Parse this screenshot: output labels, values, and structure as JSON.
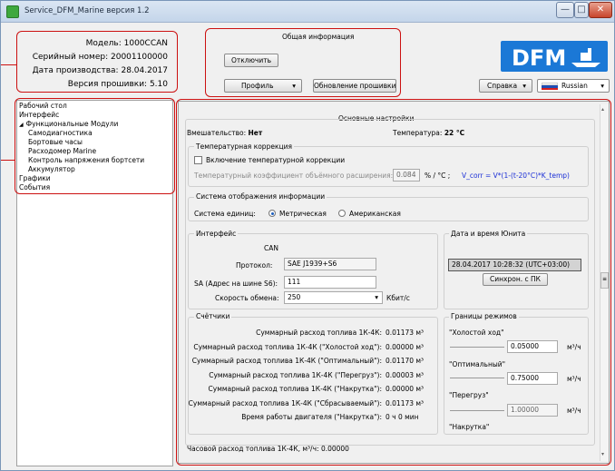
{
  "window": {
    "title": "Service_DFM_Marine версия 1.2",
    "controls": {
      "minimize": "—",
      "maximize": "□",
      "close": "✕"
    }
  },
  "device_info": {
    "model_label": "Модель:",
    "model_value": "1000CCAN",
    "serial_label": "Серийный номер:",
    "serial_value": "20001100000",
    "date_label": "Дата производства:",
    "date_value": "28.04.2017",
    "firmware_label": "Версия прошивки:",
    "firmware_value": "5.10"
  },
  "general_info": {
    "title": "Общая информация",
    "disconnect_button": "Отключить",
    "profile_button": "Профиль",
    "firmware_update_button": "Обновление прошивки",
    "help_button": "Справка",
    "language": "Russian",
    "logo_text": "DFM"
  },
  "tree": {
    "items": [
      {
        "label": "Рабочий стол",
        "level": 0
      },
      {
        "label": "Интерфейс",
        "level": 0
      },
      {
        "label": "Функциональные Модули",
        "level": 0,
        "expander": "◢"
      },
      {
        "label": "Самодиагностика",
        "level": 1
      },
      {
        "label": "Бортовые часы",
        "level": 1
      },
      {
        "label": "Расходомер Marine",
        "level": 1
      },
      {
        "label": "Контроль напряжения бортсети",
        "level": 1
      },
      {
        "label": "Аккумулятор",
        "level": 1
      },
      {
        "label": "Графики",
        "level": 0
      },
      {
        "label": "События",
        "level": 0
      }
    ]
  },
  "main": {
    "title": "Основные настройки",
    "tamper_label": "Вмешательство:",
    "tamper_value": "Нет",
    "temp_label": "Температура:",
    "temp_value": "22 °C",
    "temp_correction": {
      "title": "Температурная коррекция",
      "enable_label": "Включение температурной коррекции",
      "coef_label": "Температурный коэффициент объёмного расширения:",
      "coef_value": "0.084",
      "coef_unit": "% / °C ;",
      "formula": "V_corr = V*(1-(t-20°C)*K_temp)"
    },
    "display_system": {
      "title": "Система отображения информации",
      "units_label": "Система единиц:",
      "metric": "Метрическая",
      "american": "Американская"
    },
    "interface": {
      "title": "Интерфейс",
      "bus": "CAN",
      "protocol_label": "Протокол:",
      "protocol_value": "SAE J1939+S6",
      "sa_label": "SA (Адрес на шине S6):",
      "sa_value": "111",
      "speed_label": "Скорость обмена:",
      "speed_value": "250",
      "speed_unit": "Кбит/с"
    },
    "datetime": {
      "title": "Дата и время Юнита",
      "value": "28.04.2017 10:28:32 (UTC+03:00)",
      "sync_button": "Синхрон. с ПК"
    },
    "counters": {
      "title": "Счётчики",
      "rows": [
        {
          "label": "Суммарный расход топлива 1К-4К:",
          "value": "0.01173 м³"
        },
        {
          "label": "Суммарный расход топлива 1К-4К (\"Холостой ход\"):",
          "value": "0.00000 м³"
        },
        {
          "label": "Суммарный расход топлива 1К-4К (\"Оптимальный\"):",
          "value": "0.01170 м³"
        },
        {
          "label": "Суммарный расход топлива 1К-4К (\"Перегруз\"):",
          "value": "0.00003 м³"
        },
        {
          "label": "Суммарный расход топлива 1К-4К (\"Накрутка\"):",
          "value": "0.00000 м³"
        },
        {
          "label": "Суммарный расход топлива 1К-4К (\"Сбрасываемый\"):",
          "value": "0.01173 м³"
        },
        {
          "label": "Время работы двигателя (\"Накрутка\"):",
          "value": "0 ч 0 мин"
        }
      ]
    },
    "modes": {
      "title": "Границы режимов",
      "idle": "\"Холостой ход\"",
      "optimal": "\"Оптимальный\"",
      "overload": "\"Перегруз\"",
      "wind": "\"Накрутка\"",
      "value1": "0.05000",
      "value2": "0.75000",
      "value3": "1.00000",
      "unit": "м³/ч"
    },
    "hourly_label": "Часовой расход топлива 1К-4К, м³/ч:",
    "hourly_value": "0.00000"
  }
}
